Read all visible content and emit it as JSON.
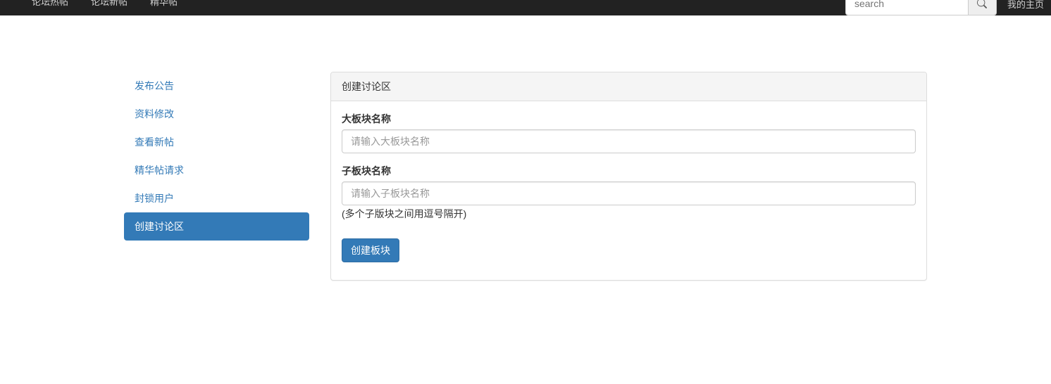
{
  "navbar": {
    "items": [
      "论坛热帖",
      "论坛新帖",
      "精华帖"
    ],
    "search_placeholder": "search",
    "user_text": "我的主页"
  },
  "sidebar": {
    "items": [
      {
        "label": "发布公告",
        "active": false
      },
      {
        "label": "资料修改",
        "active": false
      },
      {
        "label": "查看新帖",
        "active": false
      },
      {
        "label": "精华帖请求",
        "active": false
      },
      {
        "label": "封锁用户",
        "active": false
      },
      {
        "label": "创建讨论区",
        "active": true
      }
    ]
  },
  "panel": {
    "heading": "创建讨论区",
    "field1_label": "大板块名称",
    "field1_placeholder": "请输入大板块名称",
    "field2_label": "子板块名称",
    "field2_placeholder": "请输入子板块名称",
    "help_text": "(多个子版块之间用逗号隔开)",
    "submit_label": "创建板块"
  }
}
